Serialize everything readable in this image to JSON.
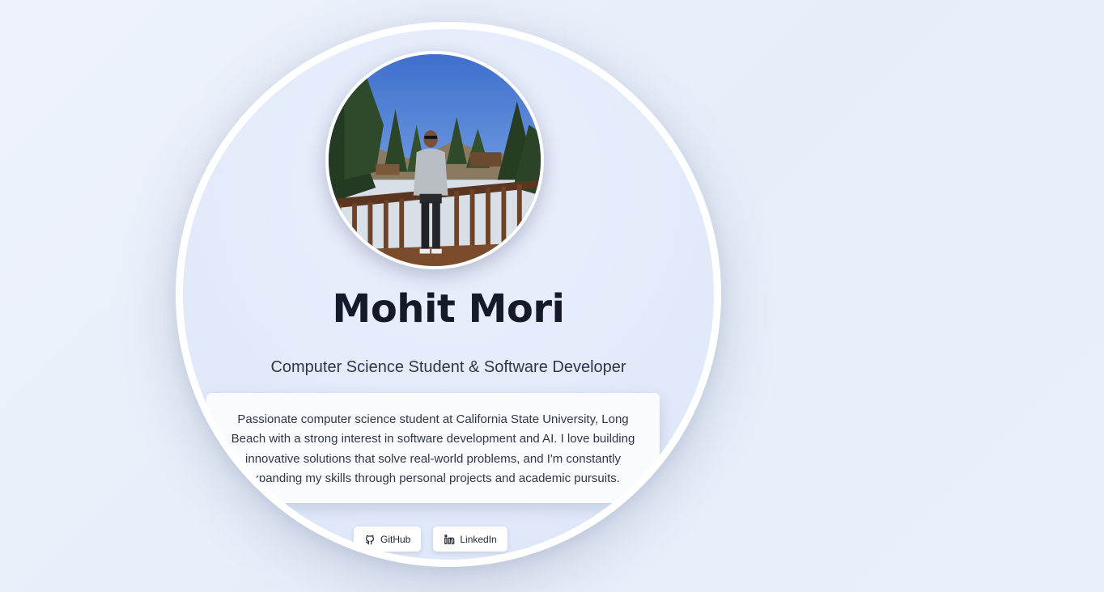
{
  "profile": {
    "name": "Mohit Mori",
    "subtitle": "Computer Science Student & Software Developer",
    "bio": "Passionate computer science student at California State University, Long Beach with a strong interest in software development and AI. I love building innovative solutions that solve real-world problems, and I'm constantly expanding my skills through personal projects and academic pursuits."
  },
  "links": [
    {
      "label": "GitHub",
      "icon": "github-icon"
    },
    {
      "label": "LinkedIn",
      "icon": "linkedin-icon"
    }
  ],
  "colors": {
    "background": "#e9f0fb",
    "heading": "#141a29",
    "text": "#2f3645",
    "card": "#ffffff"
  }
}
